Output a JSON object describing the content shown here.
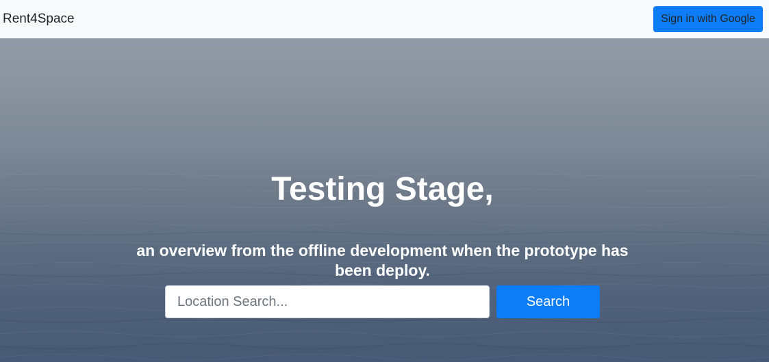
{
  "navbar": {
    "brand": "Rent4Space",
    "signin_label": "Sign in with Google"
  },
  "hero": {
    "title": "Testing Stage,",
    "subtitle": "an overview from the offline development when the prototype has been deploy.",
    "search": {
      "placeholder": "Location Search...",
      "value": "",
      "button_label": "Search"
    }
  },
  "colors": {
    "navbar_bg": "#f8f9fa",
    "primary": "#0d7cf7",
    "hero_text": "#ffffff"
  }
}
